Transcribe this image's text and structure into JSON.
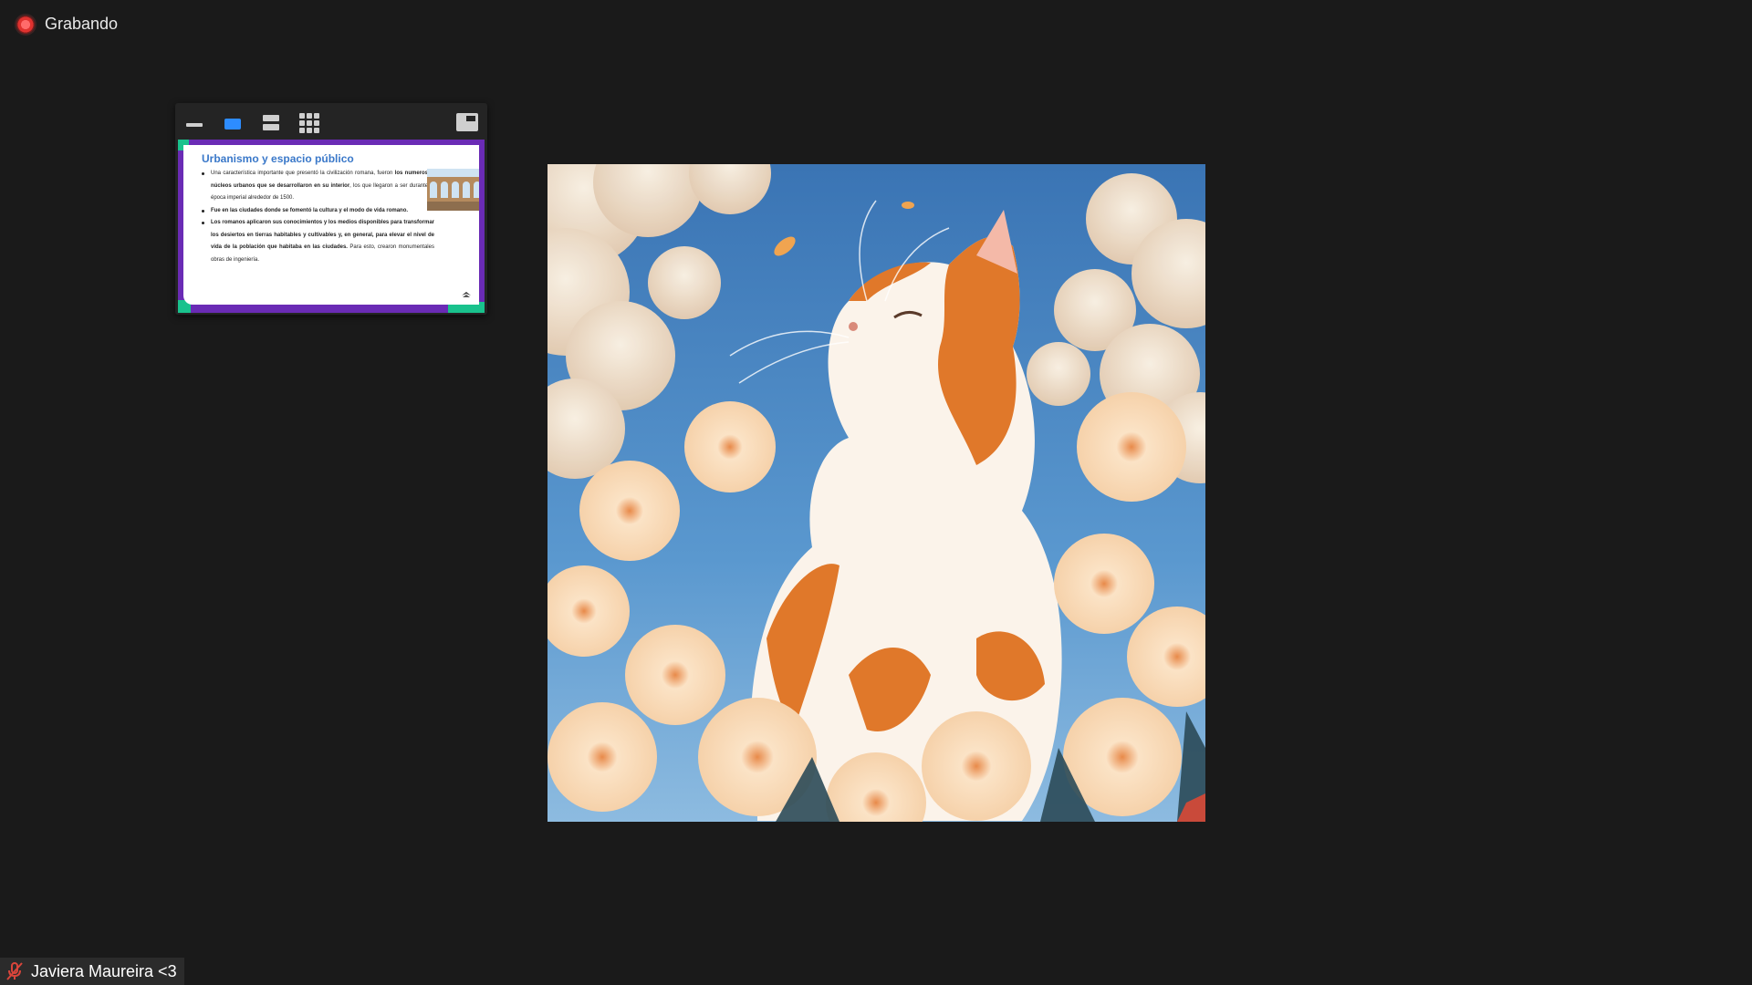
{
  "recording": {
    "label": "Grabando",
    "color": "#e0322f"
  },
  "mini_window": {
    "toolbar": {
      "icons": [
        "minimize-icon",
        "single-view-icon",
        "split-view-icon",
        "grid-view-icon",
        "picture-in-picture-icon"
      ],
      "active_color": "#2d8cff"
    },
    "slide": {
      "title": "Urbanismo y espacio público",
      "bullets": [
        {
          "parts": [
            {
              "text": "Una característica importante que presentó la civilización romana, fueron ",
              "bold": false
            },
            {
              "text": "los numerosos núcleos urbanos que se desarrollaron en su interior",
              "bold": true
            },
            {
              "text": ", los que llegaron a ser durante la época imperial alrededor de 1500.",
              "bold": false
            }
          ]
        },
        {
          "parts": [
            {
              "text": "Fue en las ciudades donde se fomentó la cultura y el modo de vida romano.",
              "bold": true
            }
          ]
        },
        {
          "parts": [
            {
              "text": "Los romanos aplicaron sus conocimientos y los medios disponibles para transformar los desiertos en tierras habitables y cultivables y, en general, para elevar el nivel de vida de la población que habitaba en las ciudades.",
              "bold": true
            },
            {
              "text": " Para esto, crearon monumentales obras de ingeniería.",
              "bold": false
            }
          ]
        }
      ],
      "accent_purple": "#6a2bb5",
      "accent_green": "#19c28d",
      "title_color": "#3a78c9"
    }
  },
  "main_image": {
    "subject": "anime-style orange and white cat among flowers under blue sky",
    "colors": {
      "sky": "#4e8ec9",
      "cloud": "#f6e6cf",
      "cat_orange": "#e0782a",
      "cat_white": "#fbf3ea",
      "flower": "#f7d8b6"
    }
  },
  "participant": {
    "name": "Javiera Maureira <3",
    "mic_status": "muted",
    "mic_icon": "microphone-muted-icon",
    "mic_color": "#d9453b"
  }
}
